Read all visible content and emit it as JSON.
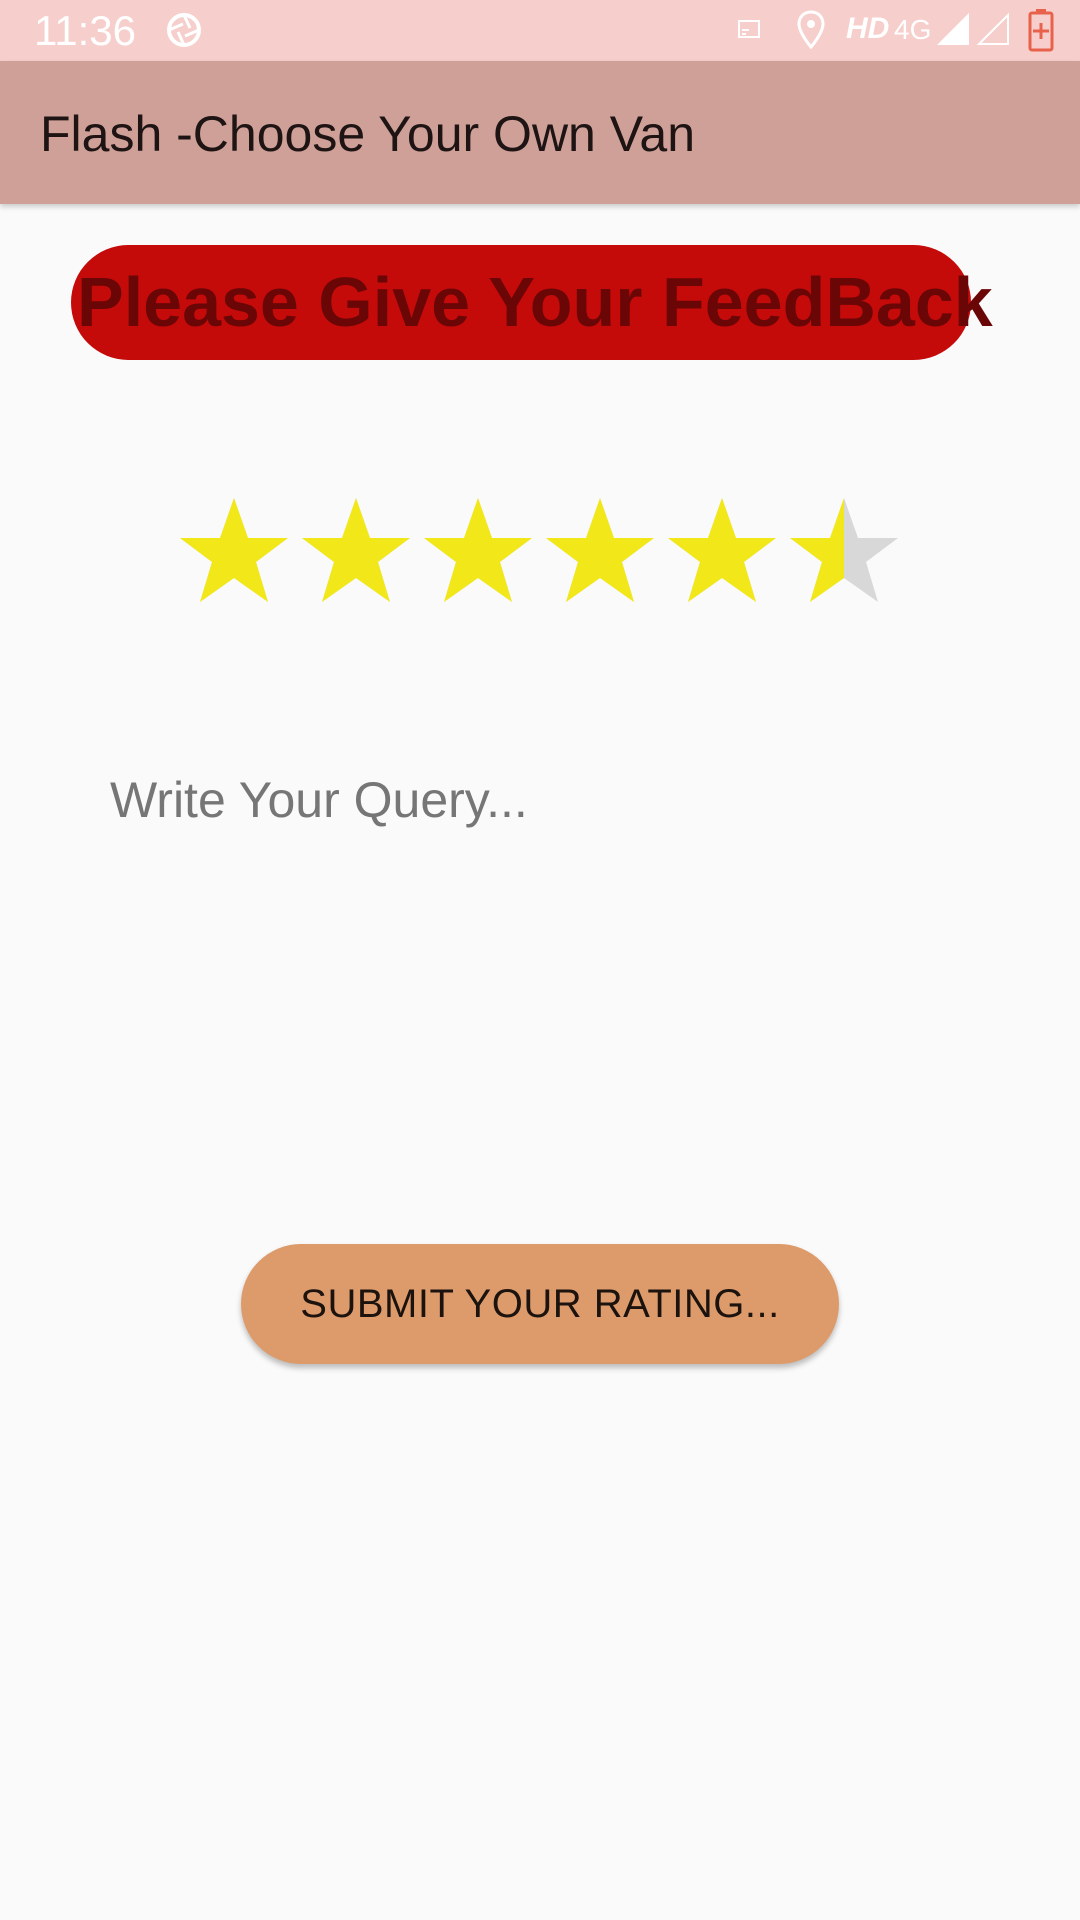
{
  "status_bar": {
    "time": "11:36",
    "hd": "HD",
    "network": "4G",
    "icons": [
      "aperture-icon",
      "cast-icon",
      "location-icon",
      "signal-icon",
      "battery-icon"
    ]
  },
  "app_bar": {
    "title": "Flash -Choose Your Own Van"
  },
  "feedback": {
    "heading": "Please Give Your FeedBack"
  },
  "rating": {
    "value": 5.5,
    "max": 6,
    "filled_color": "#f2e819",
    "empty_color": "#d8d8d8"
  },
  "query": {
    "placeholder": "Write Your Query...",
    "value": ""
  },
  "submit": {
    "label": "SUBMIT YOUR RATING..."
  },
  "colors": {
    "status_bar": "#f6cfcc",
    "app_bar": "#cfa097",
    "banner": "#c50a0a",
    "banner_text": "#6b0606",
    "button": "#dd9b6b"
  }
}
